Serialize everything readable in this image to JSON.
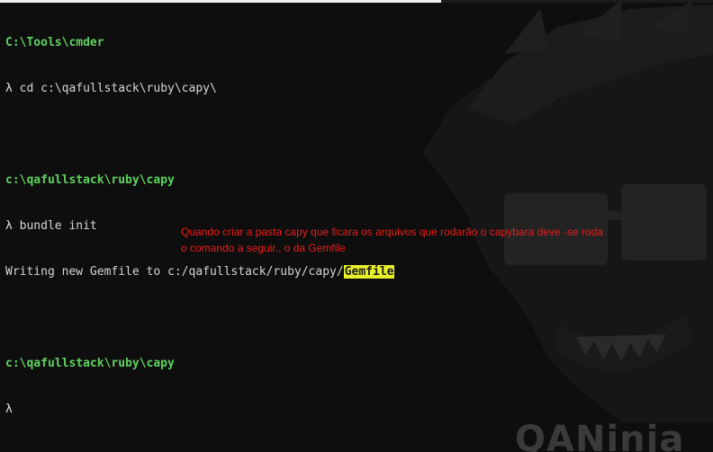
{
  "terminal": {
    "lines": [
      {
        "kind": "path",
        "text": "C:\\Tools\\cmder"
      },
      {
        "kind": "command",
        "prompt": "λ",
        "text": "cd c:\\qafullstack\\ruby\\capy\\"
      },
      {
        "kind": "blank"
      },
      {
        "kind": "path",
        "text": "c:\\qafullstack\\ruby\\capy"
      },
      {
        "kind": "command",
        "prompt": "λ",
        "text": "bundle init"
      },
      {
        "kind": "output",
        "text": "Writing new Gemfile to c:/qafullstack/ruby/capy/",
        "highlight": "Gemfile"
      },
      {
        "kind": "blank"
      },
      {
        "kind": "path",
        "text": "c:\\qafullstack\\ruby\\capy"
      },
      {
        "kind": "command",
        "prompt": "λ",
        "text": ""
      }
    ]
  },
  "annotation": {
    "line1": "Quando criar a pasta capy que ficara os arquivos que rodarão o capybara deve -se roda",
    "line2": "o comando a seguir., o da Gemfile"
  },
  "watermark": {
    "text": "QANinja"
  },
  "colors": {
    "background": "#0e0e0e",
    "path_green": "#5fd35f",
    "text": "#d6d6d6",
    "highlight": "#e8f02a",
    "annotation_red": "#ee1c1c"
  }
}
